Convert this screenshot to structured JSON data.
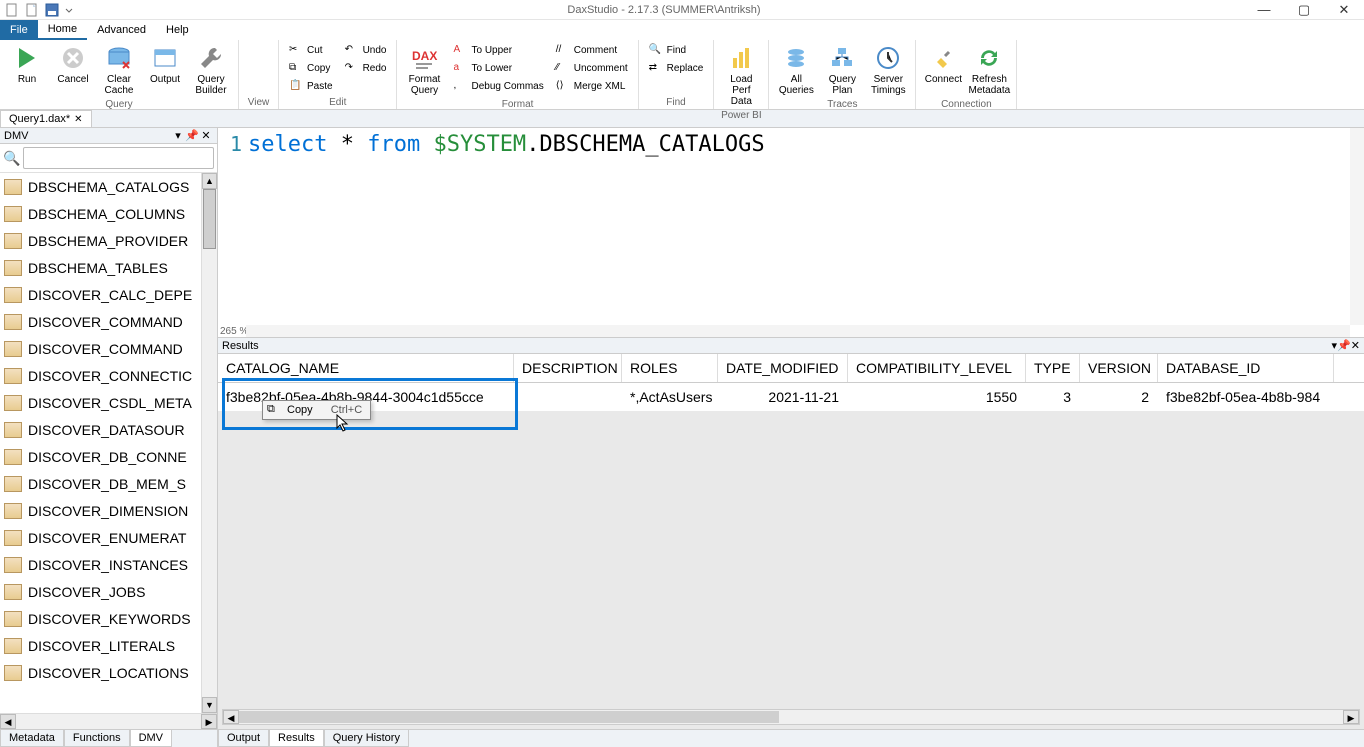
{
  "app": {
    "title": "DaxStudio - 2.17.3 (SUMMER\\Antriksh)"
  },
  "window_controls": {
    "min": "—",
    "max": "▢",
    "close": "✕"
  },
  "ribbon": {
    "tabs": {
      "file": "File",
      "home": "Home",
      "advanced": "Advanced",
      "help": "Help"
    },
    "groups": {
      "query": {
        "label": "Query",
        "run": "Run",
        "cancel": "Cancel",
        "clear_cache": "Clear\nCache",
        "output": "Output",
        "query_builder": "Query\nBuilder"
      },
      "view": {
        "label": "View"
      },
      "edit": {
        "label": "Edit",
        "cut": "Cut",
        "copy": "Copy",
        "paste": "Paste",
        "undo": "Undo",
        "redo": "Redo"
      },
      "format": {
        "label": "Format",
        "format_query": "Format\nQuery",
        "to_upper": "To Upper",
        "to_lower": "To Lower",
        "debug_commas": "Debug Commas",
        "comment": "Comment",
        "uncomment": "Uncomment",
        "merge_xml": "Merge XML"
      },
      "find": {
        "label": "Find",
        "find": "Find",
        "replace": "Replace"
      },
      "powerbi": {
        "label": "Power BI",
        "load_perf": "Load Perf\nData"
      },
      "traces": {
        "label": "Traces",
        "all_queries": "All\nQueries",
        "query_plan": "Query\nPlan",
        "server_timings": "Server\nTimings"
      },
      "connection": {
        "label": "Connection",
        "connect": "Connect",
        "refresh": "Refresh\nMetadata"
      }
    }
  },
  "doc_tab": {
    "name": "Query1.dax*"
  },
  "dmv_panel": {
    "title": "DMV",
    "search_placeholder": "",
    "items": [
      "DBSCHEMA_CATALOGS",
      "DBSCHEMA_COLUMNS",
      "DBSCHEMA_PROVIDER",
      "DBSCHEMA_TABLES",
      "DISCOVER_CALC_DEPE",
      "DISCOVER_COMMAND",
      "DISCOVER_COMMAND",
      "DISCOVER_CONNECTIC",
      "DISCOVER_CSDL_META",
      "DISCOVER_DATASOUR",
      "DISCOVER_DB_CONNE",
      "DISCOVER_DB_MEM_S",
      "DISCOVER_DIMENSION",
      "DISCOVER_ENUMERAT",
      "DISCOVER_INSTANCES",
      "DISCOVER_JOBS",
      "DISCOVER_KEYWORDS",
      "DISCOVER_LITERALS",
      "DISCOVER_LOCATIONS"
    ],
    "bottom_tabs": [
      "Metadata",
      "Functions",
      "DMV"
    ]
  },
  "editor": {
    "line_no": "1",
    "code_tokens": {
      "select": "select",
      "star": " * ",
      "from": "from",
      "sys": " $SYSTEM",
      "tail": ".DBSCHEMA_CATALOGS"
    },
    "zoom": "265 %"
  },
  "results": {
    "title": "Results",
    "columns": [
      "CATALOG_NAME",
      "DESCRIPTION",
      "ROLES",
      "DATE_MODIFIED",
      "COMPATIBILITY_LEVEL",
      "TYPE",
      "VERSION",
      "DATABASE_ID"
    ],
    "row": {
      "catalog_name": "f3be82bf-05ea-4b8b-9844-3004c1d55cce",
      "description": "",
      "roles": "*,ActAsUsers",
      "date_modified": "2021-11-21",
      "compatibility_level": "1550",
      "type": "3",
      "version": "2",
      "database_id": "f3be82bf-05ea-4b8b-984"
    },
    "bottom_tabs": [
      "Output",
      "Results",
      "Query History"
    ]
  },
  "context_menu": {
    "copy": "Copy",
    "shortcut": "Ctrl+C"
  },
  "colors": {
    "accent": "#206ba4",
    "highlight": "#0a78d6"
  }
}
